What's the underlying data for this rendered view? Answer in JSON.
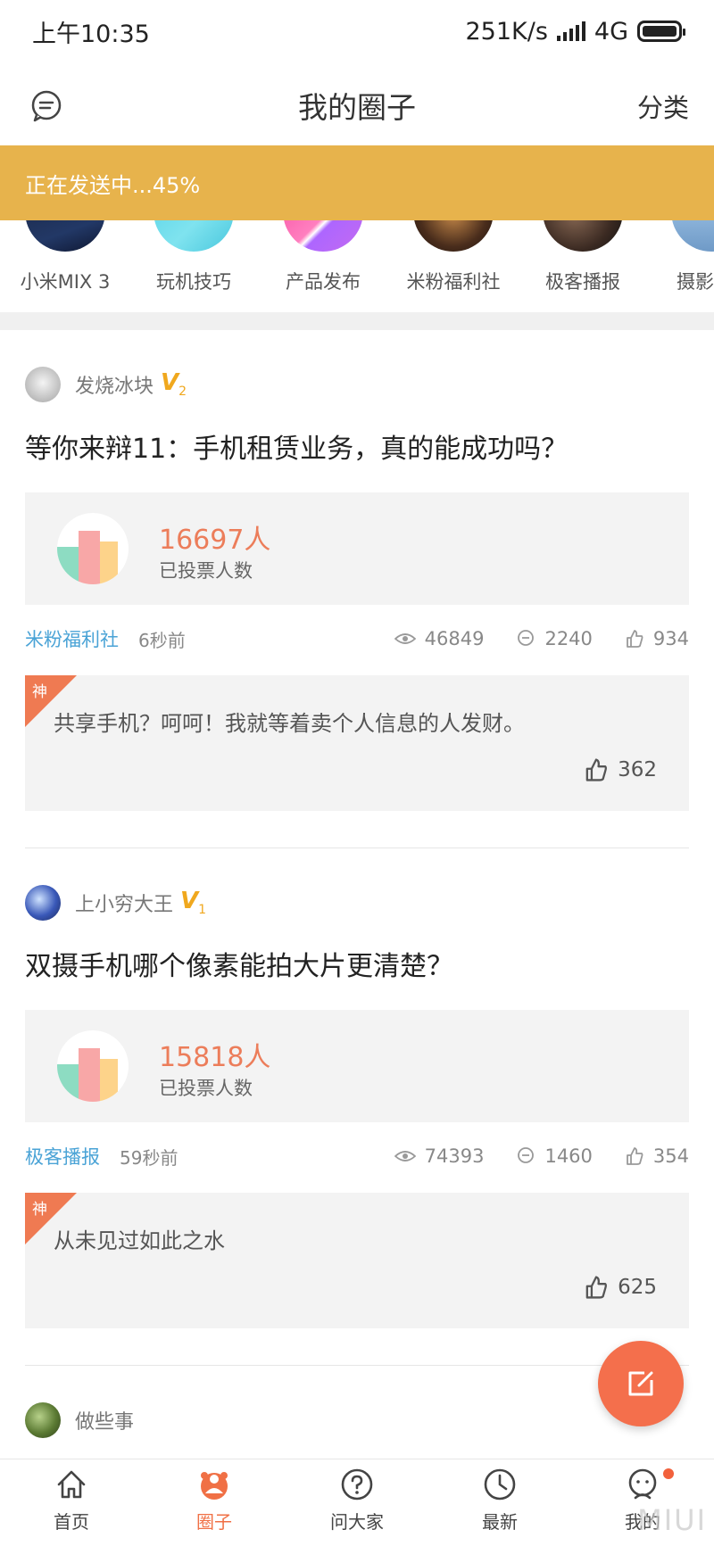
{
  "status_bar": {
    "time": "上午10:35",
    "speed": "251K/s",
    "network": "4G"
  },
  "header": {
    "title": "我的圈子",
    "right_link": "分类",
    "left_icon": "message-icon"
  },
  "banner": {
    "text": "正在发送中...45%",
    "progress_percent": 45,
    "color": "#e7b34c"
  },
  "circles": [
    {
      "label": "小米MIX 3"
    },
    {
      "label": "玩机技巧"
    },
    {
      "label": "产品发布"
    },
    {
      "label": "米粉福利社"
    },
    {
      "label": "极客播报"
    },
    {
      "label": "摄影"
    }
  ],
  "posts": [
    {
      "author": "发烧冰块",
      "level": "V",
      "level_num": "2",
      "title": "等你来辩11：手机租赁业务，真的能成功吗？",
      "vote_count": "16697人",
      "vote_label": "已投票人数",
      "tag": "米粉福利社",
      "time": "6秒前",
      "views": "46849",
      "comments": "2240",
      "likes": "934",
      "god_label": "神",
      "top_comment": "共享手机？呵呵！我就等着卖个人信息的人发财。",
      "top_comment_likes": "362"
    },
    {
      "author": "上小穷大王",
      "level": "V",
      "level_num": "1",
      "title": "双摄手机哪个像素能拍大片更清楚？",
      "vote_count": "15818人",
      "vote_label": "已投票人数",
      "tag": "极客播报",
      "time": "59秒前",
      "views": "74393",
      "comments": "1460",
      "likes": "354",
      "god_label": "神",
      "top_comment": "从未见过如此之水",
      "top_comment_likes": "625"
    },
    {
      "author": "做些事"
    }
  ],
  "bottom_nav": [
    {
      "label": "首页",
      "icon": "home-icon"
    },
    {
      "label": "圈子",
      "icon": "circle-icon",
      "active": true
    },
    {
      "label": "问大家",
      "icon": "question-icon"
    },
    {
      "label": "最新",
      "icon": "clock-icon"
    },
    {
      "label": "我的",
      "icon": "profile-icon"
    }
  ],
  "watermark": "MIUI",
  "colors": {
    "accent": "#f07045",
    "tag": "#4aa3d6",
    "vote": "#ec7d5a",
    "badge": "#f0a81e"
  }
}
